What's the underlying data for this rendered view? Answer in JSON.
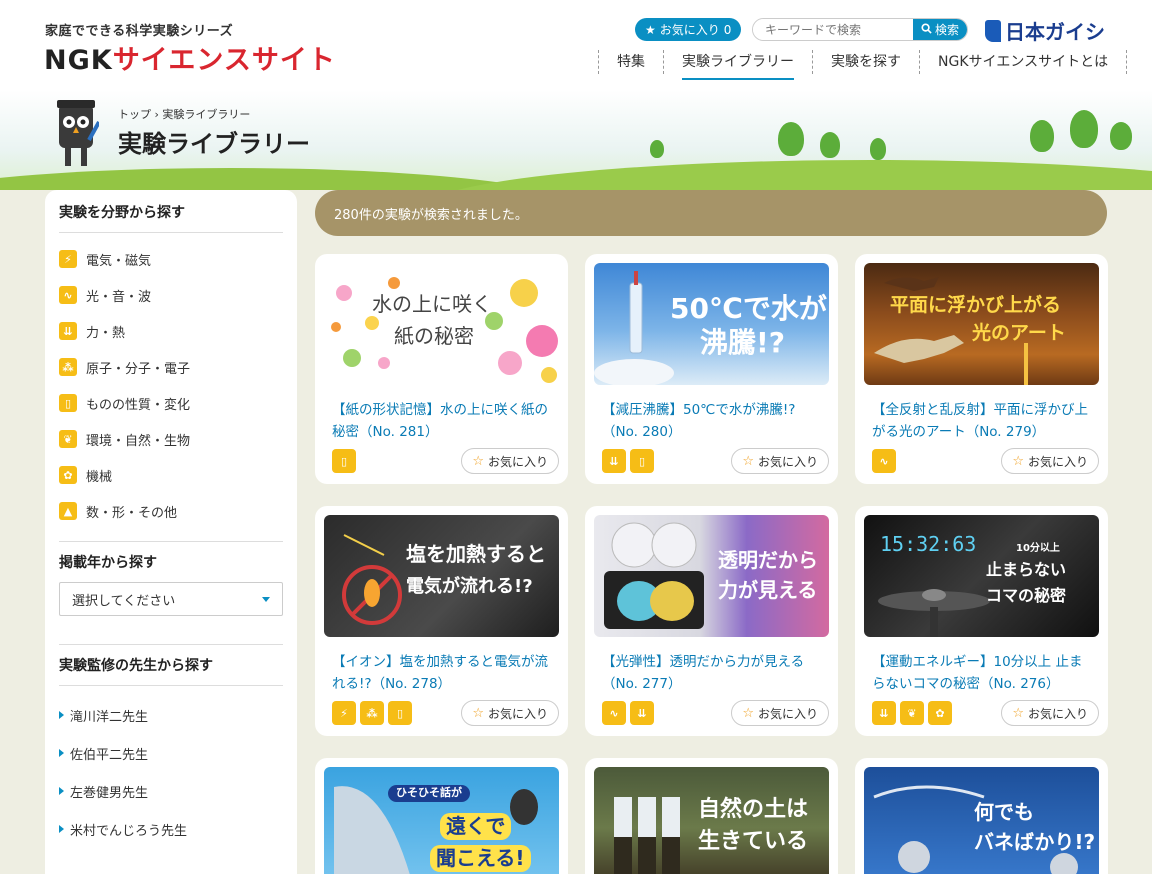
{
  "header": {
    "logo_sub": "家庭でできる科学実験シリーズ",
    "logo_part1": "NGK",
    "logo_part2": "サイエンスサイト",
    "fav_label": "お気に入り",
    "fav_count": "0",
    "search_placeholder": "キーワードで検索",
    "search_button": "検索",
    "brand": "日本ガイシ",
    "brand_sub": "NGK",
    "nav": [
      {
        "label": "特集"
      },
      {
        "label": "実験ライブラリー"
      },
      {
        "label": "実験を探す"
      },
      {
        "label": "NGKサイエンスサイトとは"
      }
    ]
  },
  "banner": {
    "breadcrumb_home": "トップ",
    "breadcrumb_current": "実験ライブラリー",
    "title": "実験ライブラリー"
  },
  "sidebar": {
    "field_heading": "実験を分野から探す",
    "fields": [
      {
        "label": "電気・磁気",
        "icon": "lightning-icon"
      },
      {
        "label": "光・音・波",
        "icon": "wave-icon"
      },
      {
        "label": "力・熱",
        "icon": "force-icon"
      },
      {
        "label": "原子・分子・電子",
        "icon": "molecule-icon"
      },
      {
        "label": "ものの性質・変化",
        "icon": "tube-icon"
      },
      {
        "label": "環境・自然・生物",
        "icon": "leaf-icon"
      },
      {
        "label": "機械",
        "icon": "gear-icon"
      },
      {
        "label": "数・形・その他",
        "icon": "shapes-icon"
      }
    ],
    "year_heading": "掲載年から探す",
    "year_select": "選択してください",
    "teacher_heading": "実験監修の先生から探す",
    "teachers": [
      {
        "label": "滝川洋二先生"
      },
      {
        "label": "佐伯平二先生"
      },
      {
        "label": "左巻健男先生"
      },
      {
        "label": "米村でんじろう先生"
      }
    ]
  },
  "results": {
    "message": "280件の実験が検索されました。"
  },
  "cards": [
    {
      "title": "【紙の形状記憶】水の上に咲く紙の秘密（No. 281）",
      "thumb_line1": "水の上に咲く",
      "thumb_line2": "紙の秘密",
      "icons": [
        "tube-icon"
      ],
      "fav": "お気に入り"
    },
    {
      "title": "【減圧沸騰】50℃で水が沸騰!?（No. 280）",
      "thumb_line1": "50℃で水が",
      "thumb_line2": "沸騰!?",
      "icons": [
        "force-icon",
        "tube-icon"
      ],
      "fav": "お気に入り"
    },
    {
      "title": "【全反射と乱反射】平面に浮かび上がる光のアート（No. 279）",
      "thumb_line1": "平面に浮かび上がる",
      "thumb_line2": "光のアート",
      "icons": [
        "wave-icon"
      ],
      "fav": "お気に入り"
    },
    {
      "title": "【イオン】塩を加熱すると電気が流れる!?（No. 278）",
      "thumb_line1": "塩を加熱すると",
      "thumb_line2": "電気が流れる!?",
      "icons": [
        "lightning-icon",
        "molecule-icon",
        "tube-icon"
      ],
      "fav": "お気に入り"
    },
    {
      "title": "【光弾性】透明だから力が見える（No. 277）",
      "thumb_line1": "透明だから",
      "thumb_line2": "力が見える",
      "icons": [
        "wave-icon",
        "force-icon"
      ],
      "fav": "お気に入り"
    },
    {
      "title": "【運動エネルギー】10分以上 止まらないコマの秘密（No. 276）",
      "thumb_badge": "10分以上",
      "thumb_line1": "止まらない",
      "thumb_line2": "コマの秘密",
      "thumb_clock": "15:32:63",
      "icons": [
        "force-icon",
        "leaf-icon",
        "gear-icon"
      ],
      "fav": "お気に入り"
    },
    {
      "thumb_badge": "ひそひそ話が",
      "thumb_line1": "遠くで",
      "thumb_line2": "聞こえる!"
    },
    {
      "thumb_line1": "自然の土は",
      "thumb_line2": "生きている"
    },
    {
      "thumb_line1": "何でも",
      "thumb_line2": "バネばかり!?"
    }
  ],
  "colors": {
    "accent": "#0a8fc3",
    "category": "#f6bd16",
    "result_bar": "#a69468",
    "link": "#0a7bb5"
  }
}
